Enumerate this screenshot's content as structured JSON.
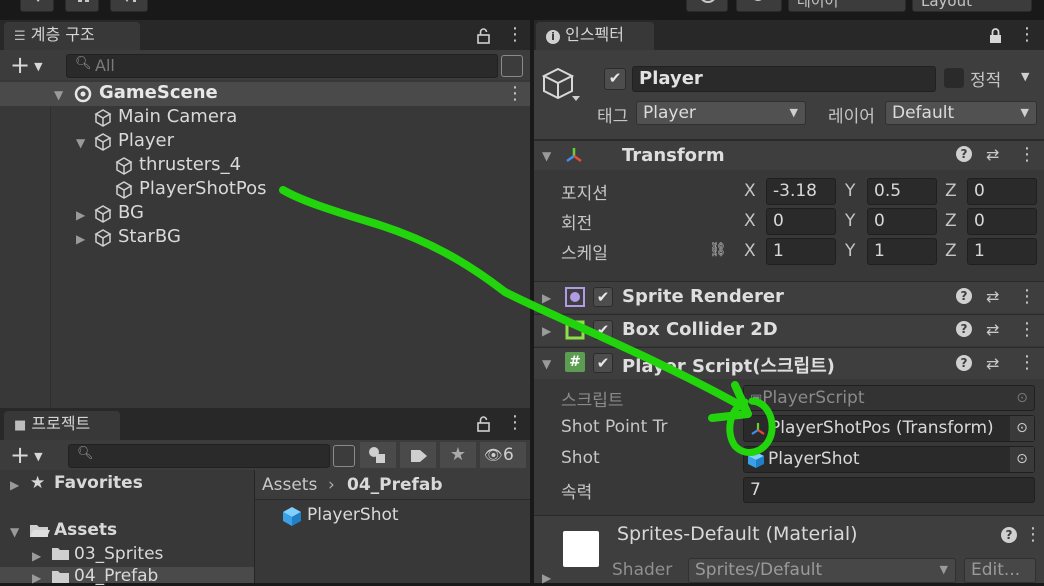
{
  "toolbar": {
    "layers_label": "레이어",
    "layout_label": "Layout"
  },
  "hierarchy": {
    "tab_label": "계층 구조",
    "search_placeholder": "All",
    "scene_name": "GameScene",
    "items": [
      "Main Camera",
      "Player",
      "thrusters_4",
      "PlayerShotPos",
      "BG",
      "StarBG"
    ]
  },
  "project": {
    "tab_label": "프로젝트",
    "hidden_count": "6",
    "favorites_label": "Favorites",
    "assets_label": "Assets",
    "folders": [
      "03_Sprites",
      "04_Prefab"
    ],
    "breadcrumb_root": "Assets",
    "breadcrumb_current": "04_Prefab",
    "files": [
      "PlayerShot"
    ]
  },
  "inspector": {
    "tab_label": "인스펙터",
    "object_name": "Player",
    "static_label": "정적",
    "tag_label": "태그",
    "tag_value": "Player",
    "layer_label": "레이어",
    "layer_value": "Default",
    "transform": {
      "title": "Transform",
      "position_label": "포지션",
      "rotation_label": "회전",
      "scale_label": "스케일",
      "position": {
        "x": "-3.18",
        "y": "0.5",
        "z": "0"
      },
      "rotation": {
        "x": "0",
        "y": "0",
        "z": "0"
      },
      "scale": {
        "x": "1",
        "y": "1",
        "z": "1"
      }
    },
    "sprite_renderer_title": "Sprite Renderer",
    "box_collider_title": "Box Collider 2D",
    "player_script": {
      "title": "Player Script(스크립트)",
      "script_label": "스크립트",
      "script_value": "PlayerScript",
      "shot_point_label": "Shot Point Tr",
      "shot_point_value": "PlayerShotPos (Transform)",
      "shot_label": "Shot",
      "shot_value": "PlayerShot",
      "speed_label": "속력",
      "speed_value": "7"
    },
    "material": {
      "title": "Sprites-Default (Material)",
      "shader_label": "Shader",
      "shader_value": "Sprites/Default",
      "edit_label": "Edit..."
    }
  },
  "colors": {
    "annotation_arrow": "#22d40c",
    "panel_bg": "#383838",
    "header_bg": "#3e3e3e"
  }
}
